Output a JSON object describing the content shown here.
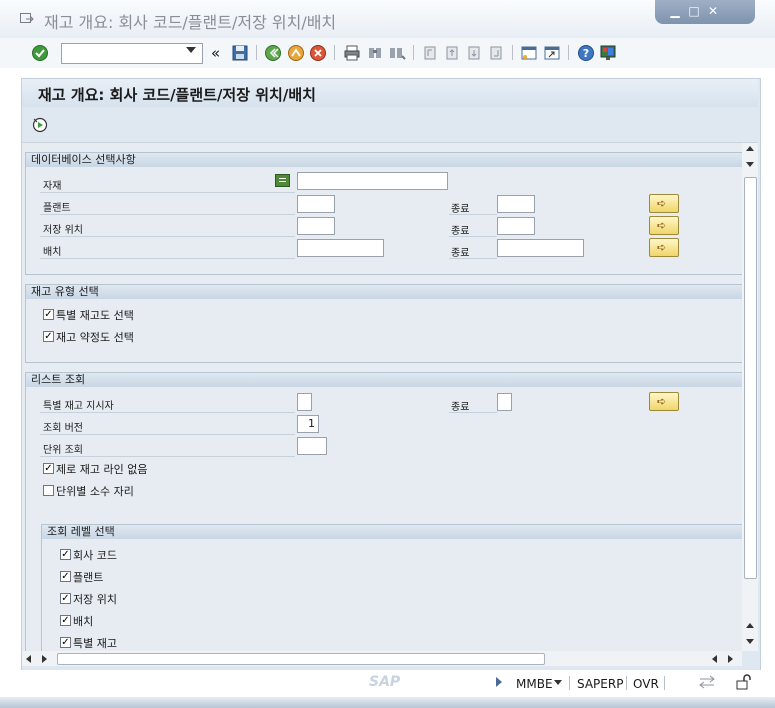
{
  "window": {
    "title": "재고 개요: 회사 코드/플랜트/저장 위치/배치",
    "controls": {
      "minimize": "▁",
      "maximize": "□",
      "close": "✕"
    }
  },
  "toolbar": {
    "command_field_value": "",
    "prev_label": "«",
    "icons": [
      "enter-icon",
      "save-icon",
      "back-icon",
      "exit-icon",
      "cancel-icon",
      "print-icon",
      "find-icon",
      "find-next-icon",
      "first-page-icon",
      "prev-page-icon",
      "next-page-icon",
      "last-page-icon",
      "new-session-icon",
      "shortcut-icon",
      "help-icon",
      "layout-menu-icon"
    ]
  },
  "screen": {
    "title": "재고 개요: 회사 코드/플랜트/저장 위치/배치"
  },
  "db_selection": {
    "header": "데이터베이스 선택사항",
    "material_label": "자재",
    "material_value": "",
    "plant_label": "플랜트",
    "plant_value": "",
    "plant_to_label": "종료",
    "plant_to_value": "",
    "sloc_label": "저장 위치",
    "sloc_value": "",
    "sloc_to_label": "종료",
    "sloc_to_value": "",
    "batch_label": "배치",
    "batch_value": "",
    "batch_to_label": "종료",
    "batch_to_value": ""
  },
  "stock_type": {
    "header": "재고 유형 선택",
    "special_stock_label": "특별 재고도 선택",
    "special_stock_checked": true,
    "consignment_label": "재고 약정도 선택",
    "consignment_checked": true
  },
  "list_display": {
    "header": "리스트 조회",
    "special_indicator_label": "특별 재고 지시자",
    "special_indicator_value": "",
    "special_indicator_to_label": "종료",
    "special_indicator_to_value": "",
    "display_version_label": "조회 버전",
    "display_version_value": "1",
    "unit_display_label": "단위 조회",
    "unit_display_value": "",
    "no_zero_label": "제로 재고 라인 없음",
    "no_zero_checked": true,
    "decimal_places_label": "단위별 소수 자리",
    "decimal_places_checked": false
  },
  "level_selection": {
    "header": "조회 레벨 선택",
    "items": [
      {
        "label": "회사 코드",
        "checked": true
      },
      {
        "label": "플랜트",
        "checked": true
      },
      {
        "label": "저장 위치",
        "checked": true
      },
      {
        "label": "배치",
        "checked": true
      },
      {
        "label": "특별 재고",
        "checked": true
      }
    ]
  },
  "status_bar": {
    "logo": "SAP",
    "transaction": "MMBE",
    "system": "SAPERP",
    "mode": "OVR"
  },
  "colors": {
    "accent": "#dfe8f1",
    "header_bg": "#c8d6e4",
    "button_yellow": "#f0d66a"
  }
}
